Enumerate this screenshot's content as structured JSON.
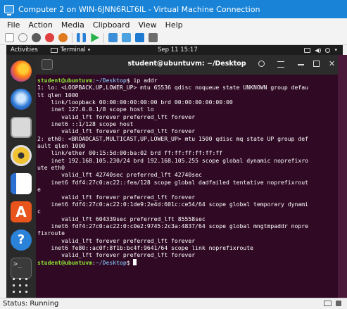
{
  "window": {
    "title": "Computer 2 on WIN-6JNN6RLT6IL - Virtual Machine Connection"
  },
  "menu": [
    "File",
    "Action",
    "Media",
    "Clipboard",
    "View",
    "Help"
  ],
  "topbar": {
    "activities": "Activities",
    "app_name": "Terminal",
    "clock": "Sep 11  15:17"
  },
  "terminal": {
    "title": "student@ubuntuvm: ~/Desktop",
    "prompt_user": "student@ubuntuvm",
    "prompt_path": "~/Desktop",
    "command": "ip addr",
    "output": [
      "1: lo: <LOOPBACK,UP,LOWER_UP> mtu 65536 qdisc noqueue state UNKNOWN group defau",
      "lt qlen 1000",
      "    link/loopback 00:00:00:00:00:00 brd 00:00:00:00:00:00",
      "    inet 127.0.0.1/8 scope host lo",
      "       valid_lft forever preferred_lft forever",
      "    inet6 ::1/128 scope host",
      "       valid_lft forever preferred_lft forever",
      "2: eth0: <BROADCAST,MULTICAST,UP,LOWER_UP> mtu 1500 qdisc mq state UP group def",
      "ault qlen 1000",
      "    link/ether 00:15:5d:00:ba:02 brd ff:ff:ff:ff:ff:ff",
      "    inet 192.168.105.230/24 brd 192.168.105.255 scope global dynamic noprefixro",
      "ute eth0",
      "       valid_lft 42740sec preferred_lft 42740sec",
      "    inet6 fdf4:27c0:ac22::fea/128 scope global dadfailed tentative noprefixrout",
      "e",
      "       valid_lft forever preferred_lft forever",
      "    inet6 fdf4:27c0:ac22:0:1de9:2e4d:601c:ce54/64 scope global temporary dynami",
      "c",
      "       valid_lft 604339sec preferred_lft 85558sec",
      "    inet6 fdf4:27c0:ac22:0:c0e2:9745:2c3a:4837/64 scope global mngtmpaddr nopre",
      "fixroute",
      "       valid_lft forever preferred_lft forever",
      "    inet6 fe80::ac0f:8f1b:bc4f:9641/64 scope link noprefixroute",
      "       valid_lft forever preferred_lft forever"
    ]
  },
  "status": {
    "text": "Status: Running"
  },
  "colors": {
    "terminal_bg": "#300a24",
    "prompt_user": "#8ae234",
    "prompt_path": "#729fcf",
    "titlebar": "#1883d7"
  }
}
